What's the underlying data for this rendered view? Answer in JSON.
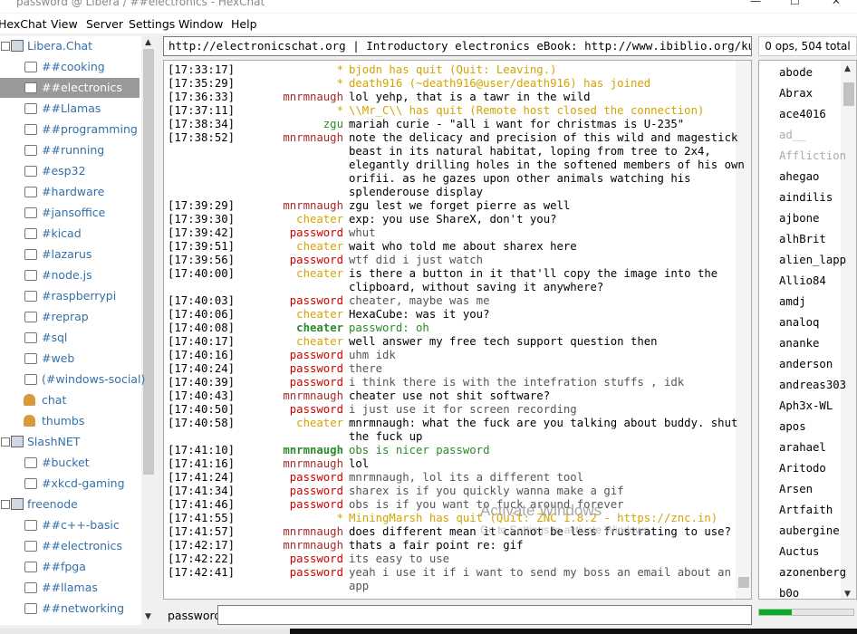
{
  "window": {
    "title": "password @ Libera / ##electronics - HexChat",
    "minimize": "—",
    "maximize": "☐",
    "close": "✕"
  },
  "menu": {
    "hexchat": "HexChat",
    "view": "View",
    "server": "Server",
    "settings": "Settings",
    "window": "Window",
    "help": "Help"
  },
  "tree": [
    {
      "label": "Libera.Chat",
      "type": "network",
      "expander": "−"
    },
    {
      "label": "##cooking",
      "type": "channel"
    },
    {
      "label": "##electronics",
      "type": "channel",
      "selected": true
    },
    {
      "label": "##Llamas",
      "type": "channel"
    },
    {
      "label": "##programming",
      "type": "channel"
    },
    {
      "label": "##running",
      "type": "channel"
    },
    {
      "label": "#esp32",
      "type": "channel"
    },
    {
      "label": "#hardware",
      "type": "channel"
    },
    {
      "label": "#jansoffice",
      "type": "channel"
    },
    {
      "label": "#kicad",
      "type": "channel"
    },
    {
      "label": "#lazarus",
      "type": "channel"
    },
    {
      "label": "#node.js",
      "type": "channel"
    },
    {
      "label": "#raspberrypi",
      "type": "channel"
    },
    {
      "label": "#reprap",
      "type": "channel"
    },
    {
      "label": "#sql",
      "type": "channel"
    },
    {
      "label": "#web",
      "type": "channel"
    },
    {
      "label": "(#windows-social)",
      "type": "channel"
    },
    {
      "label": "chat",
      "type": "query"
    },
    {
      "label": "thumbs",
      "type": "query"
    },
    {
      "label": "SlashNET",
      "type": "network",
      "expander": "−"
    },
    {
      "label": "#bucket",
      "type": "channel"
    },
    {
      "label": "#xkcd-gaming",
      "type": "channel"
    },
    {
      "label": "freenode",
      "type": "network",
      "expander": "−"
    },
    {
      "label": "##c++-basic",
      "type": "channel"
    },
    {
      "label": "##electronics",
      "type": "channel"
    },
    {
      "label": "##fpga",
      "type": "channel"
    },
    {
      "label": "##llamas",
      "type": "channel"
    },
    {
      "label": "##networking",
      "type": "channel"
    }
  ],
  "topic": "http://electronicschat.org | Introductory electronics eBook: http://www.ibiblio.org/kuphaldt",
  "ops_count": "0 ops, 504 total",
  "messages": [
    {
      "ts": "[17:33:17]",
      "nick": "*",
      "nc": "#d4a400",
      "text": "bjodn has quit (Quit: Leaving.)",
      "tc": "#d4a400"
    },
    {
      "ts": "[17:35:29]",
      "nick": "*",
      "nc": "#d4a400",
      "text": "death916 (~death916@user/death916) has joined",
      "tc": "#d4a400"
    },
    {
      "ts": "[17:36:33]",
      "nick": "mnrmnaugh",
      "nc": "#a52a2a",
      "text": "lol yehp, that is a tawr in the wild",
      "tc": "#000"
    },
    {
      "ts": "[17:37:11]",
      "nick": "*",
      "nc": "#d4a400",
      "text": "\\\\Mr_C\\\\ has quit (Remote host closed the connection)",
      "tc": "#d4a400"
    },
    {
      "ts": "[17:38:34]",
      "nick": "zgu",
      "nc": "#2a8a2a",
      "text": "mariah curie - \"all i want for christmas is U-235\"",
      "tc": "#000"
    },
    {
      "ts": "[17:38:52]",
      "nick": "mnrmnaugh",
      "nc": "#a52a2a",
      "text": "note the delicacy and precision of this wild and magestick",
      "tc": "#000"
    },
    {
      "ts": "",
      "nick": "",
      "nc": "#000",
      "text": "beast in its natural habitat, loping from tree to 2x4,",
      "tc": "#000"
    },
    {
      "ts": "",
      "nick": "",
      "nc": "#000",
      "text": "elegantly drilling holes in the softened members of his own",
      "tc": "#000"
    },
    {
      "ts": "",
      "nick": "",
      "nc": "#000",
      "text": "orifii. as he gazes upon other animals watching his",
      "tc": "#000"
    },
    {
      "ts": "",
      "nick": "",
      "nc": "#000",
      "text": "splenderouse display",
      "tc": "#000"
    },
    {
      "ts": "[17:39:29]",
      "nick": "mnrmnaugh",
      "nc": "#a52a2a",
      "text": "zgu lest we forget pierre as well",
      "tc": "#000"
    },
    {
      "ts": "[17:39:30]",
      "nick": "cheater",
      "nc": "#d4a400",
      "text": "exp: you use ShareX, don't you?",
      "tc": "#000"
    },
    {
      "ts": "[17:39:42]",
      "nick": "password",
      "nc": "#cc0000",
      "text": "whut",
      "tc": "#555"
    },
    {
      "ts": "[17:39:51]",
      "nick": "cheater",
      "nc": "#d4a400",
      "text": "wait who told me about sharex here",
      "tc": "#000"
    },
    {
      "ts": "[17:39:56]",
      "nick": "password",
      "nc": "#cc0000",
      "text": "wtf did i just watch",
      "tc": "#555"
    },
    {
      "ts": "[17:40:00]",
      "nick": "cheater",
      "nc": "#d4a400",
      "text": "is there a button in it that'll copy the image into the",
      "tc": "#000"
    },
    {
      "ts": "",
      "nick": "",
      "nc": "#000",
      "text": "clipboard, without saving it anywhere?",
      "tc": "#000"
    },
    {
      "ts": "[17:40:03]",
      "nick": "password",
      "nc": "#cc0000",
      "text": "cheater,  maybe was me",
      "tc": "#555"
    },
    {
      "ts": "[17:40:06]",
      "nick": "cheater",
      "nc": "#d4a400",
      "text": "HexaCube: was it you?",
      "tc": "#000"
    },
    {
      "ts": "[17:40:08]",
      "nick": "cheater",
      "nc": "#2a8a2a",
      "text": "password: oh",
      "tc": "#2a8a2a",
      "bold": true
    },
    {
      "ts": "[17:40:17]",
      "nick": "cheater",
      "nc": "#d4a400",
      "text": "well answer my free tech support question then",
      "tc": "#000"
    },
    {
      "ts": "[17:40:16]",
      "nick": "password",
      "nc": "#cc0000",
      "text": "uhm idk",
      "tc": "#555"
    },
    {
      "ts": "[17:40:24]",
      "nick": "password",
      "nc": "#cc0000",
      "text": "there",
      "tc": "#555"
    },
    {
      "ts": "[17:40:39]",
      "nick": "password",
      "nc": "#cc0000",
      "text": "i think there is with the intefration stuffs , idk",
      "tc": "#555"
    },
    {
      "ts": "[17:40:43]",
      "nick": "mnrmnaugh",
      "nc": "#a52a2a",
      "text": "cheater use not shit software?",
      "tc": "#000"
    },
    {
      "ts": "[17:40:50]",
      "nick": "password",
      "nc": "#cc0000",
      "text": "i just use it for screen recording",
      "tc": "#555"
    },
    {
      "ts": "[17:40:58]",
      "nick": "cheater",
      "nc": "#d4a400",
      "text": "mnrmnaugh: what the fuck are you talking about buddy. shut",
      "tc": "#000"
    },
    {
      "ts": "",
      "nick": "",
      "nc": "#000",
      "text": "the fuck up",
      "tc": "#000"
    },
    {
      "ts": "[17:41:10]",
      "nick": "mnrmnaugh",
      "nc": "#2a8a2a",
      "text": "obs is nicer password",
      "tc": "#2a8a2a",
      "bold": true
    },
    {
      "ts": "[17:41:16]",
      "nick": "mnrmnaugh",
      "nc": "#a52a2a",
      "text": "lol",
      "tc": "#000"
    },
    {
      "ts": "[17:41:24]",
      "nick": "password",
      "nc": "#cc0000",
      "text": "mnrmnaugh, lol its a different tool",
      "tc": "#555"
    },
    {
      "ts": "[17:41:34]",
      "nick": "password",
      "nc": "#cc0000",
      "text": "sharex is if you quickly wanna make a gif",
      "tc": "#555"
    },
    {
      "ts": "[17:41:46]",
      "nick": "password",
      "nc": "#cc0000",
      "text": "obs is if you want to fuck around forever",
      "tc": "#555"
    },
    {
      "ts": "[17:41:55]",
      "nick": "*",
      "nc": "#d4a400",
      "text": "MiningMarsh has quit (Quit: ZNC 1.8.2 - https://znc.in)",
      "tc": "#d4a400"
    },
    {
      "ts": "[17:41:57]",
      "nick": "mnrmnaugh",
      "nc": "#a52a2a",
      "text": "does different mean it cannot be less frustrating to use?",
      "tc": "#000"
    },
    {
      "ts": "[17:42:17]",
      "nick": "mnrmnaugh",
      "nc": "#a52a2a",
      "text": "thats a fair point re: gif",
      "tc": "#000"
    },
    {
      "ts": "[17:42:22]",
      "nick": "password",
      "nc": "#cc0000",
      "text": "its easy to use",
      "tc": "#555"
    },
    {
      "ts": "[17:42:41]",
      "nick": "password",
      "nc": "#cc0000",
      "text": "yeah i use it if i want to send my boss an email about an",
      "tc": "#555"
    },
    {
      "ts": "",
      "nick": "",
      "nc": "#000",
      "text": "app",
      "tc": "#555"
    }
  ],
  "users": [
    {
      "n": "abode"
    },
    {
      "n": "Abrax"
    },
    {
      "n": "ace4016"
    },
    {
      "n": "ad__",
      "away": true
    },
    {
      "n": "Affliction",
      "away": true
    },
    {
      "n": "ahegao"
    },
    {
      "n": "aindilis"
    },
    {
      "n": "ajbone"
    },
    {
      "n": "alhBrit"
    },
    {
      "n": "alien_lapp"
    },
    {
      "n": "Allio84"
    },
    {
      "n": "amdj"
    },
    {
      "n": "analoq"
    },
    {
      "n": "ananke"
    },
    {
      "n": "anderson"
    },
    {
      "n": "andreas303"
    },
    {
      "n": "Aph3x-WL"
    },
    {
      "n": "apos"
    },
    {
      "n": "arahael"
    },
    {
      "n": "Aritodo"
    },
    {
      "n": "Arsen"
    },
    {
      "n": "Artfaith"
    },
    {
      "n": "aubergine"
    },
    {
      "n": "Auctus"
    },
    {
      "n": "azonenberg"
    },
    {
      "n": "b0o"
    }
  ],
  "input": {
    "nick": "password",
    "value": ""
  },
  "lag_fraction": 0.35,
  "watermark": {
    "line1": "Activate Windows",
    "line2": "Go to Settings to activate Windows."
  },
  "colors": {
    "channel": "#3470a8",
    "selected_bg": "#999999",
    "lag": "#06b025"
  }
}
